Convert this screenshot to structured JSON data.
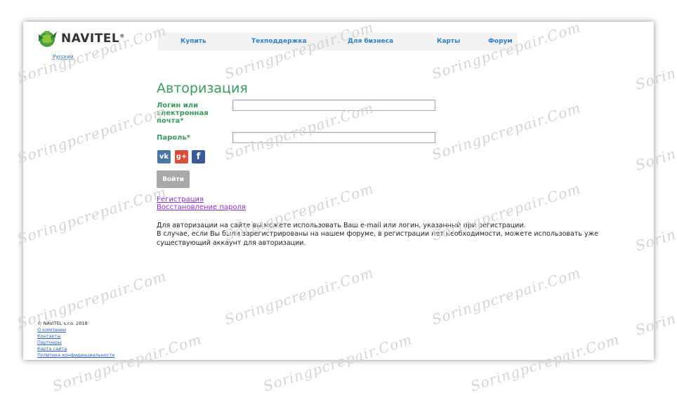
{
  "logo": {
    "brand": "NAVITEL",
    "reg": "®"
  },
  "language": "Русский",
  "nav": [
    {
      "label": "Купить"
    },
    {
      "label": "Техподдержка"
    },
    {
      "label": "Для бизнеса"
    },
    {
      "label": "Карты"
    },
    {
      "label": "Форум"
    }
  ],
  "page_title": "Авторизация",
  "form": {
    "login_label_1": "Логин или",
    "login_label_2": "электронная",
    "login_label_3": "почта*",
    "login_value": "",
    "password_label": "Пароль*",
    "password_value": "",
    "submit": "Войти"
  },
  "social": {
    "vk": "vk",
    "gplus": "g+",
    "facebook": "f"
  },
  "links": {
    "register": "Регистрация",
    "restore": "Восстановление пароля"
  },
  "info": {
    "line1": "Для авторизации на сайте вы можете использовать Ваш e-mail или логин, указанный при регистрации.",
    "line2": "В случае, если Вы были зарегистрированы на нашем форуме, в регистрации нет необходимости, можете использовать уже",
    "line3": "существующий аккаунт для авторизации."
  },
  "footer": {
    "copyright": "© NAVITEL s.r.o. 2018",
    "links": [
      "О компании",
      "Контакты",
      "Партнеры",
      "Карта сайта",
      "Политика конфиденциальности"
    ]
  },
  "watermark": "Soringpcrepair.Com",
  "colors": {
    "accent_green": "#3a9a5c",
    "nav_blue": "#2f7fc8",
    "link_purple": "#8b2fc9",
    "button_gray": "#a8aaa9"
  }
}
